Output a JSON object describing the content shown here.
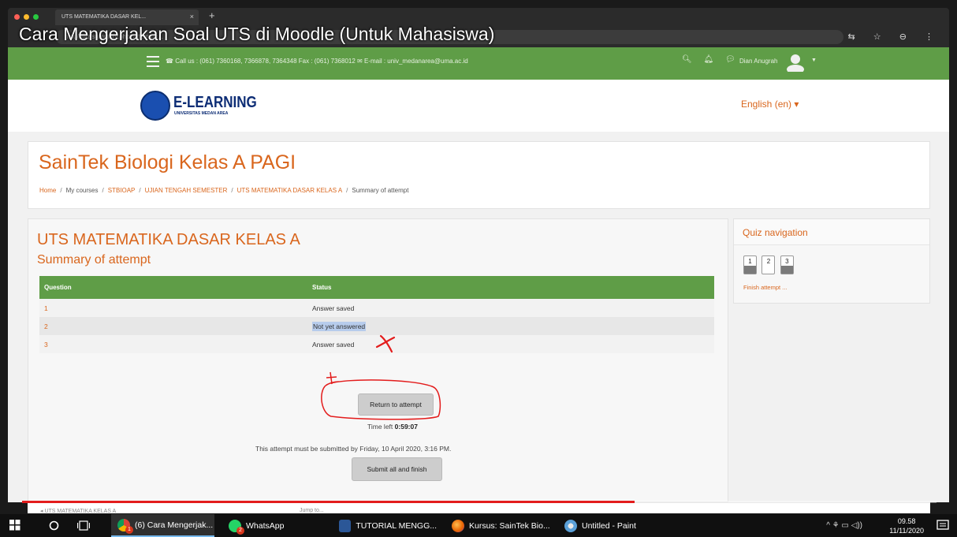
{
  "video": {
    "title": "Cara Mengerjakan Soal UTS di Moodle (Untuk Mahasiswa)",
    "progress_fraction": 0.67
  },
  "browser": {
    "tab_title": "UTS MATEMATIKA DASAR KEL...",
    "tab_close": "×",
    "new_tab": "+",
    "url": "mod/quiz/summary.php?attempt=...",
    "icons": "⇆ ☆ ⊖ ⋮"
  },
  "navbar": {
    "contact": "☎ Call us : (061) 7360168, 7366878, 7364348 Fax : (061) 7368012 ✉ E-mail : univ_medanarea@uma.ac.id",
    "user_name": "Dian Anugrah",
    "user_caret": "▼"
  },
  "header": {
    "logo_title": "E-LEARNING",
    "logo_subtitle": "UNIVERSITAS MEDAN AREA",
    "language": "English (en) ▾"
  },
  "course": {
    "title": "SainTek Biologi Kelas A PAGI",
    "breadcrumb": [
      "Home",
      "My courses",
      "STBIOAP",
      "UJIAN TENGAH SEMESTER",
      "UTS MATEMATIKA DASAR KELAS A",
      "Summary of attempt"
    ]
  },
  "quiz": {
    "title": "UTS MATEMATIKA DASAR KELAS A",
    "summary_heading": "Summary of attempt",
    "table": {
      "headers": [
        "Question",
        "Status"
      ],
      "rows": [
        {
          "question": "1",
          "status": "Answer saved"
        },
        {
          "question": "2",
          "status": "Not yet answered"
        },
        {
          "question": "3",
          "status": "Answer saved"
        }
      ]
    },
    "return_label": "Return to attempt",
    "time_left_label": "Time left",
    "time_left_value": "0:59:07",
    "submit_note": "This attempt must be submitted by Friday, 10 April 2020, 3:16 PM.",
    "submit_label": "Submit all and finish"
  },
  "quiz_nav": {
    "title": "Quiz navigation",
    "buttons": [
      "1",
      "2",
      "3"
    ],
    "finish_link": "Finish attempt ..."
  },
  "footer_strip": {
    "left": "◂ UTS MATEMATIKA KELAS A",
    "mid": "Jump to..."
  },
  "taskbar": {
    "items": [
      {
        "label": "(6) Cara Mengerjak...",
        "badge": "1"
      },
      {
        "label": "WhatsApp",
        "badge": "2"
      },
      {
        "label": "TUTORIAL MENGG..."
      },
      {
        "label": "Kursus: SainTek Bio..."
      },
      {
        "label": "Untitled - Paint"
      }
    ],
    "tray": "^ ⚘ ▭ ◁))",
    "clock_time": "09.58",
    "clock_date": "11/11/2020"
  },
  "colors": {
    "brand_green": "#5f9d47",
    "brand_orange": "#d9661d",
    "annotation_red": "#e31c1c"
  }
}
